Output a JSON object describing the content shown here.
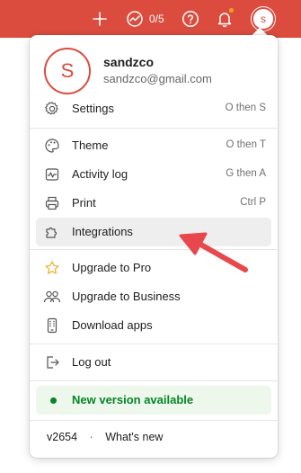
{
  "topbar": {
    "karma_count": "0/5",
    "avatar_initial": "s"
  },
  "profile": {
    "avatar_initial": "S",
    "name": "sandzco",
    "email": "sandzco@gmail.com"
  },
  "menu": {
    "settings": {
      "label": "Settings",
      "shortcut": "O then S"
    },
    "theme": {
      "label": "Theme",
      "shortcut": "O then T"
    },
    "activity_log": {
      "label": "Activity log",
      "shortcut": "G then A"
    },
    "print": {
      "label": "Print",
      "shortcut": "Ctrl P"
    },
    "integrations": {
      "label": "Integrations"
    },
    "upgrade_pro": {
      "label": "Upgrade to Pro"
    },
    "upgrade_business": {
      "label": "Upgrade to Business"
    },
    "download_apps": {
      "label": "Download apps"
    },
    "logout": {
      "label": "Log out"
    }
  },
  "new_version": {
    "label": "New version available"
  },
  "footer": {
    "version": "v2654",
    "separator": "·",
    "whats_new": "What's new"
  },
  "colors": {
    "brand": "#db4c3f",
    "success": "#058527",
    "upgrade_star": "#f2b230",
    "arrow": "#e8474b"
  }
}
